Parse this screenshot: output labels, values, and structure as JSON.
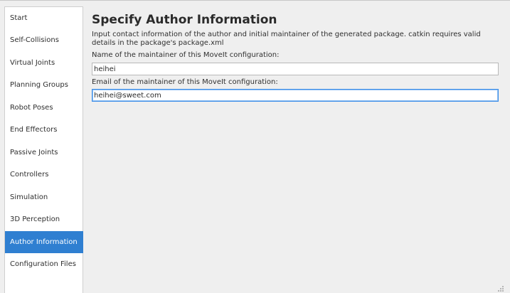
{
  "sidebar": {
    "items": [
      {
        "label": "Start",
        "selected": false
      },
      {
        "label": "Self-Collisions",
        "selected": false
      },
      {
        "label": "Virtual Joints",
        "selected": false
      },
      {
        "label": "Planning Groups",
        "selected": false
      },
      {
        "label": "Robot Poses",
        "selected": false
      },
      {
        "label": "End Effectors",
        "selected": false
      },
      {
        "label": "Passive Joints",
        "selected": false
      },
      {
        "label": "Controllers",
        "selected": false
      },
      {
        "label": "Simulation",
        "selected": false
      },
      {
        "label": "3D Perception",
        "selected": false
      },
      {
        "label": "Author Information",
        "selected": true
      },
      {
        "label": "Configuration Files",
        "selected": false
      }
    ],
    "selected_color": "#2f7fd1"
  },
  "main": {
    "title": "Specify Author Information",
    "description": "Input contact information of the author and initial maintainer of the generated package. catkin requires valid details in the package's package.xml",
    "name_label": "Name of the maintainer of this MoveIt configuration:",
    "name_value": "heihei",
    "email_label": "Email of the maintainer of this MoveIt configuration:",
    "email_value": "heihei@sweet.com"
  }
}
